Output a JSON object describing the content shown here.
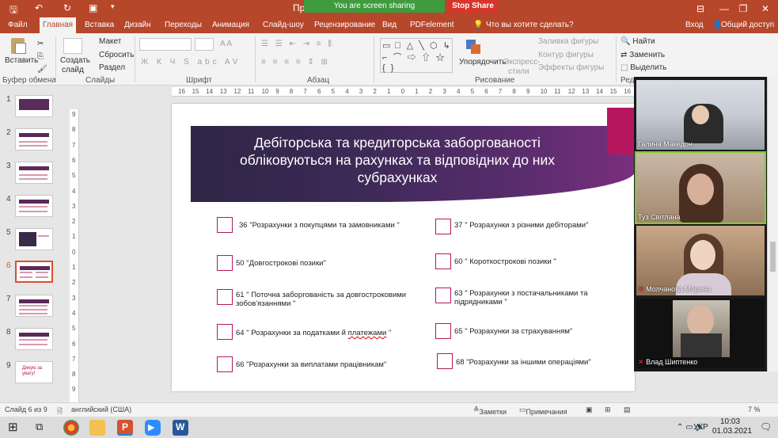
{
  "titlebar": {
    "title": "Пр...",
    "share_banner": "You are screen sharing",
    "stop_share": "Stop Share",
    "minimize": "—",
    "restore": "❐",
    "close": "✕"
  },
  "tabs": [
    "Файл",
    "Главная",
    "Вставка",
    "Дизайн",
    "Переходы",
    "Анимация",
    "Слайд-шоу",
    "Рецензирование",
    "Вид",
    "PDFelement",
    "Что вы хотите сделать?",
    "Вход",
    "Общий доступ"
  ],
  "ribbon": {
    "paste": "Вставить",
    "create_slide": "Создать",
    "create_slide2": "слайд",
    "layout": "Макет",
    "reset": "Сбросить",
    "section": "Раздел",
    "groups": [
      "Буфер обмена",
      "Слайды",
      "Шрифт",
      "Абзац",
      "Рисование",
      "Реда..."
    ],
    "font_buttons": "Ж К Ч S abc AV",
    "arrange": "Упорядочить",
    "express": "Экспресс-",
    "express2": "стили",
    "fill": "Заливка фигуры",
    "outline": "Контур фигуры",
    "effects": "Эффекты фигуры",
    "find": "Найти",
    "replace": "Заменить",
    "select": "Выделить"
  },
  "ruler": {
    "h": [
      "16",
      "15",
      "14",
      "13",
      "12",
      "11",
      "10",
      "9",
      "8",
      "7",
      "6",
      "5",
      "4",
      "3",
      "2",
      "1",
      "0",
      "1",
      "2",
      "3",
      "4",
      "5",
      "6",
      "7",
      "8",
      "9",
      "10",
      "11",
      "12",
      "13",
      "14",
      "15",
      "16"
    ],
    "v": [
      "9",
      "8",
      "7",
      "6",
      "5",
      "4",
      "3",
      "2",
      "1",
      "0",
      "1",
      "2",
      "3",
      "4",
      "5",
      "6",
      "7",
      "8",
      "9"
    ]
  },
  "thumbnails": [
    "1",
    "2",
    "3",
    "4",
    "5",
    "6",
    "7",
    "8",
    "9"
  ],
  "thumb9_text": "Дякую за увагу!",
  "slide": {
    "title": "Дебіторська та кредиторська заборгованості обліковуються  на рахунках та відповідних до них субрахунках",
    "items_left": [
      "36 \"Розрахунки з покупцями та замовниками \"",
      "50 \"Довгострокові позики\"",
      "61 \" Поточна заборгованість за довгостроковими зобов'язаннями \"",
      "64 \" Розрахунки за податками й ",
      "66 \"Розрахунки за виплатами працівникам\""
    ],
    "item64_wavy": "платежами",
    "item64_end": " \"",
    "items_right": [
      "37 \" Розрахунки з різними дебіторами\"",
      "60  \" Короткострокові позики \"",
      "63 \" Розрахунки з постачальниками та підрядниками \"",
      "65 \" Розрахунки за страхуванням\"",
      "68 \"Розрахунки за іншими операціями\""
    ]
  },
  "status": {
    "slide_count": "Слайд 6 из 9",
    "language": "английский (США)",
    "notes": "Заметки",
    "comments": "Примечания",
    "zoom": "7 %"
  },
  "taskbar": {
    "lang": "УКР",
    "time": "10:03",
    "date": "01.03.2021"
  },
  "participants": [
    "Галина Македон",
    "Туз Світлана",
    "Молчанова Марина",
    "Влад Шиптенко"
  ],
  "colors": {
    "accent": "#b7472a",
    "slide_magenta": "#b5175f",
    "share_green": "#3e9b3e",
    "stop_red": "#d9342b"
  }
}
